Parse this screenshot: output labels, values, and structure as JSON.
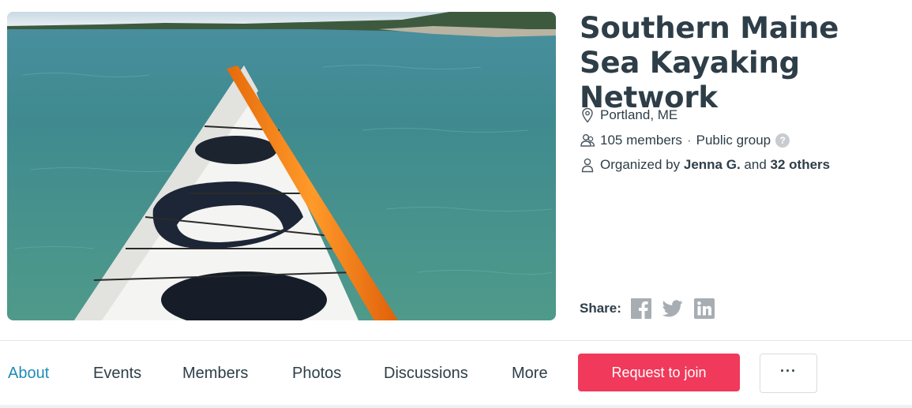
{
  "group": {
    "title": "Southern Maine Sea Kayaking Network",
    "location": "Portland, ME",
    "members": "105 members",
    "privacy": "Public group",
    "help": "?",
    "organized_prefix": "Organized by",
    "organizer": "Jenna G.",
    "organized_and": "and",
    "organized_others": "32 others"
  },
  "share": {
    "label": "Share:",
    "icons": [
      "facebook-icon",
      "twitter-icon",
      "linkedin-icon"
    ]
  },
  "nav": {
    "tabs": [
      "About",
      "Events",
      "Members",
      "Photos",
      "Discussions",
      "More"
    ],
    "active": "About",
    "join_label": "Request to join",
    "more_label": "···"
  },
  "colors": {
    "accent_link": "#1e8bb8",
    "join_button": "#f0395b",
    "text": "#2e3e48",
    "icon_gray": "#a7adb2"
  },
  "photo": {
    "subject": "kayak-bow-on-water-image"
  }
}
